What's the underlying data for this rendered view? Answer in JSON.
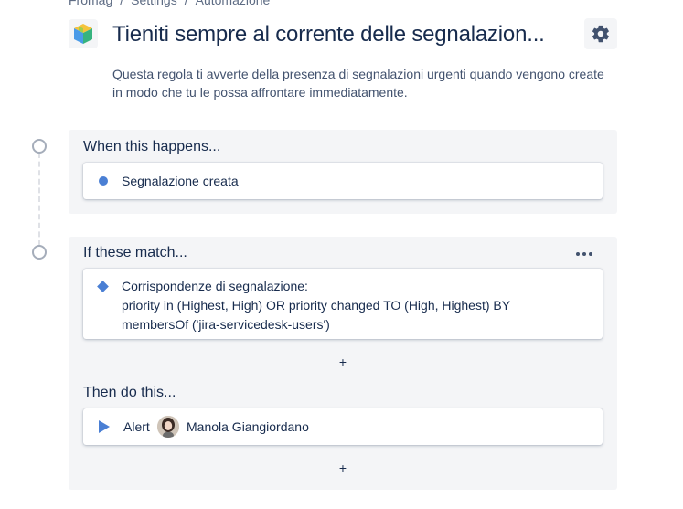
{
  "breadcrumb": {
    "items": [
      "Fromag",
      "Settings",
      "Automazione"
    ],
    "separator": "/"
  },
  "header": {
    "title": "Tieniti sempre al corrente delle segnalazion...",
    "description": "Questa regola ti avverte della presenza di segnalazioni urgenti quando vengono create in modo che tu le possa affrontare immediatamente."
  },
  "trigger": {
    "heading": "When this happens...",
    "card_label": "Segnalazione creata"
  },
  "condition": {
    "heading": "If these match...",
    "card_line1": "Corrispondenze di segnalazione:",
    "card_line2": "priority in (Highest, High) OR priority changed TO (High, Highest) BY",
    "card_line3": "membersOf ('jira-servicedesk-users')",
    "add_label": "+"
  },
  "action": {
    "heading": "Then do this...",
    "action_type": "Alert",
    "assignee": "Manola Giangiordano",
    "add_label": "+"
  },
  "colors": {
    "accent": "#4a7fd4",
    "panel_bg": "#f4f5f7",
    "text": "#172b4d"
  },
  "icons": {
    "app": "jira-cube-icon",
    "settings": "gear-icon",
    "trigger": "dot-icon",
    "condition": "diamond-icon",
    "action": "play-icon",
    "more": "more-horizontal-icon"
  }
}
